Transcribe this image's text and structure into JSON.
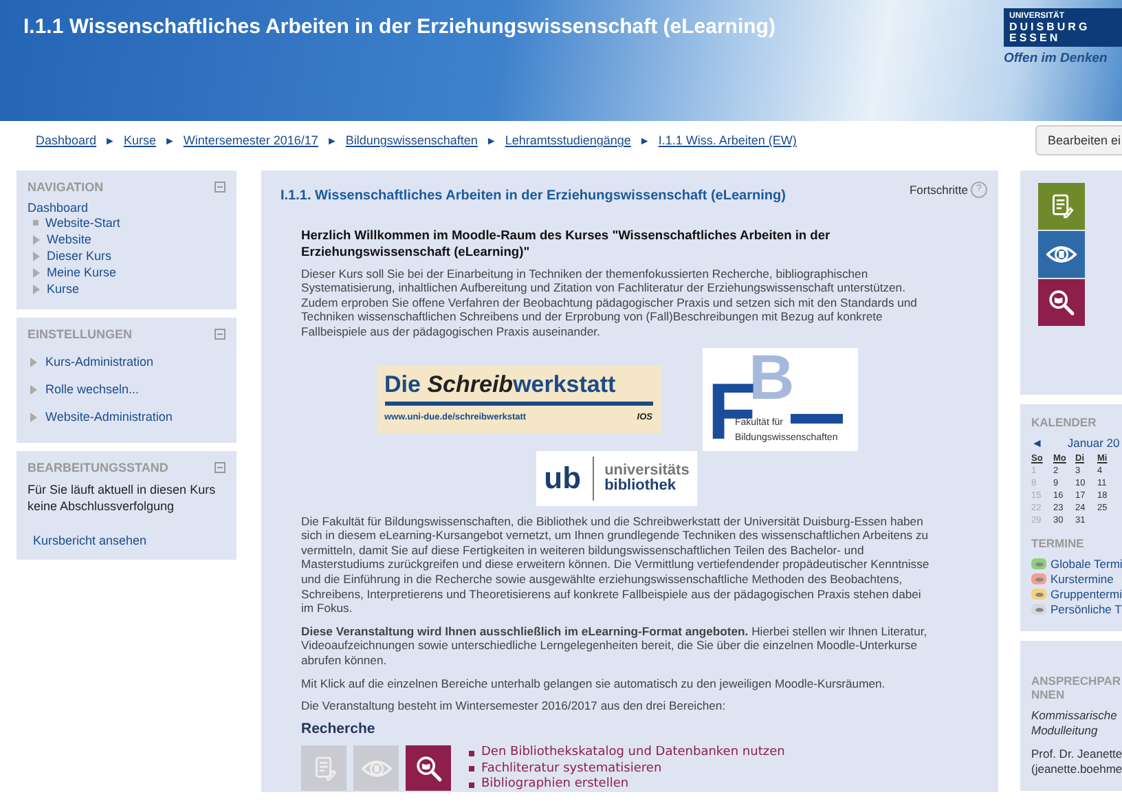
{
  "header": {
    "title": "I.1.1 Wissenschaftliches Arbeiten in der Erziehungswissenschaft (eLearning)",
    "logo": {
      "top": "UNIVERSITÄT",
      "middle": "DUISBURG",
      "bottom": "ESSEN",
      "slogan": "Offen im Denken"
    }
  },
  "breadcrumb": [
    "Dashboard",
    "Kurse",
    "Wintersemester 2016/17",
    "Bildungswissenschaften",
    "Lehramtsstudiengänge",
    "I.1.1 Wiss. Arbeiten (EW)"
  ],
  "breadcrumb_separator": "►",
  "edit_button": "Bearbeiten ei",
  "navigation": {
    "title": "NAVIGATION",
    "root": "Dashboard",
    "items": [
      {
        "label": "Website-Start",
        "kind": "leaf"
      },
      {
        "label": "Website",
        "kind": "branch"
      },
      {
        "label": "Dieser Kurs",
        "kind": "branch"
      },
      {
        "label": "Meine Kurse",
        "kind": "branch"
      },
      {
        "label": "Kurse",
        "kind": "branch"
      }
    ]
  },
  "settings": {
    "title": "EINSTELLUNGEN",
    "items": [
      "Kurs-Administration",
      "Rolle wechseln...",
      "Website-Administration"
    ]
  },
  "progress_block": {
    "title": "BEARBEITUNGSSTAND",
    "text": "Für Sie läuft aktuell in diesen Kurs keine Abschlussverfolgung",
    "link": "Kursbericht ansehen"
  },
  "main": {
    "title": "I.1.1. Wissenschaftliches Arbeiten in der Erziehungswissenschaft (eLearning)",
    "progress_label": "Fortschritte",
    "help": "?",
    "welcome": "Herzlich Willkommen im Moodle-Raum des Kurses \"Wissenschaftliches Arbeiten in der Erziehungswissenschaft (eLearning)\"",
    "intro": "Dieser Kurs soll Sie bei der Einarbeitung in Techniken der themenfokussierten Recherche, bibliographischen Systematisierung, inhaltlichen Aufbereitung und Zitation von Fachliteratur der Erziehungswissenschaft unterstützen. Zudem erproben Sie offene Verfahren der Beobachtung pädagogischer Praxis und setzen sich mit den Standards und Techniken wissenschaftlichen Schreibens und der Erprobung von (Fall)Beschreibungen mit Bezug auf konkrete Fallbeispiele aus der pädagogischen Praxis auseinander.",
    "logo_schreibwerkstatt": {
      "name_start": "Die",
      "name_italic": "Schreib",
      "name_end": "werkstatt",
      "url": "www.uni-due.de/schreibwerkstatt",
      "tag": "IOS"
    },
    "logo_fakultaet": {
      "letter_left": "F",
      "letter_right": "B",
      "line1": "Fakultät für",
      "line2": "Bildungswissenschaften"
    },
    "logo_bibliothek": {
      "short": "ub",
      "line1": "universitäts",
      "line2": "bibliothek"
    },
    "paragraphs": [
      "Die Fakultät für Bildungswissenschaften, die Bibliothek und die Schreibwerkstatt der Universität Duisburg-Essen haben sich in diesem eLearning-Kursangebot vernetzt, um Ihnen grundlegende Techniken des wissenschaftlichen Arbeitens zu vermitteln, damit Sie auf diese Fertigkeiten in weiteren bildungswissenschaftlichen Teilen des Bachelor- und Masterstudiums zurückgreifen und diese erweitern können. Die Vermittlung vertiefendender propädeutischer Kenntnisse und die Einführung in die Recherche sowie ausgewählte erziehungswissenschaftliche Methoden des Beobachtens, Schreibens, Interpretierens und Theoretisierens auf konkrete Fallbeispiele aus der pädagogischen Praxis stehen dabei im Fokus.",
      "**Diese Veranstaltung wird Ihnen ausschließlich im eLearning-Format angeboten.** Hierbei stellen wir Ihnen Literatur, Videoaufzeichnungen sowie unterschiedliche Lerngelegenheiten bereit, die Sie über die einzelnen Moodle-Unterkurse abrufen können.",
      "Mit Klick auf die einzelnen Bereiche unterhalb gelangen sie automatisch zu den jeweiligen Moodle-Kursräumen.",
      "Die Veranstaltung besteht im Wintersemester 2016/2017 aus den drei Bereichen:"
    ],
    "section": {
      "title": "Recherche",
      "tiles": [
        {
          "kind": "write",
          "active": false
        },
        {
          "kind": "observe",
          "active": false
        },
        {
          "kind": "search",
          "active": true
        }
      ],
      "links": [
        "Den Bibliothekskatalog und Datenbanken nutzen",
        "Fachliteratur systematisieren",
        "Bibliographien erstellen"
      ]
    }
  },
  "area_tiles": [
    {
      "kind": "write",
      "color": "#6f8a2a"
    },
    {
      "kind": "observe",
      "color": "#2f6aa8"
    },
    {
      "kind": "search",
      "color": "#8e1f4a"
    }
  ],
  "calendar": {
    "title": "KALENDER",
    "prev": "◄",
    "month": "Januar 20",
    "weekdays": [
      "So",
      "Mo",
      "Di",
      "Mi"
    ],
    "weeks": [
      [
        {
          "day": "1",
          "muted": true
        },
        {
          "day": "2",
          "muted": false
        },
        {
          "day": "3",
          "muted": false
        },
        {
          "day": "4",
          "muted": false
        }
      ],
      [
        {
          "day": "8",
          "muted": true
        },
        {
          "day": "9",
          "muted": false
        },
        {
          "day": "10",
          "muted": false
        },
        {
          "day": "11",
          "muted": false
        }
      ],
      [
        {
          "day": "15",
          "muted": true
        },
        {
          "day": "16",
          "muted": false
        },
        {
          "day": "17",
          "muted": false
        },
        {
          "day": "18",
          "muted": false
        }
      ],
      [
        {
          "day": "22",
          "muted": true
        },
        {
          "day": "23",
          "muted": false
        },
        {
          "day": "24",
          "muted": false
        },
        {
          "day": "25",
          "muted": false
        }
      ],
      [
        {
          "day": "29",
          "muted": true
        },
        {
          "day": "30",
          "muted": false
        },
        {
          "day": "31",
          "muted": false
        }
      ]
    ]
  },
  "events": {
    "title": "TERMINE",
    "items": [
      {
        "label": "Globale Termi",
        "color": "#8fd07a"
      },
      {
        "label": "Kurstermine",
        "color": "#f3a08c"
      },
      {
        "label": "Gruppentermi",
        "color": "#f8d27a"
      },
      {
        "label": "Persönliche T",
        "color": "#d5d8df"
      }
    ]
  },
  "contacts": {
    "title_lines": [
      "ANSPRECHPAR",
      "NNEN"
    ],
    "role_lines": [
      "Kommissarische",
      "Modulleitung"
    ],
    "person_lines": [
      "Prof. Dr. Jeanette",
      "(jeanette.boehme"
    ]
  }
}
